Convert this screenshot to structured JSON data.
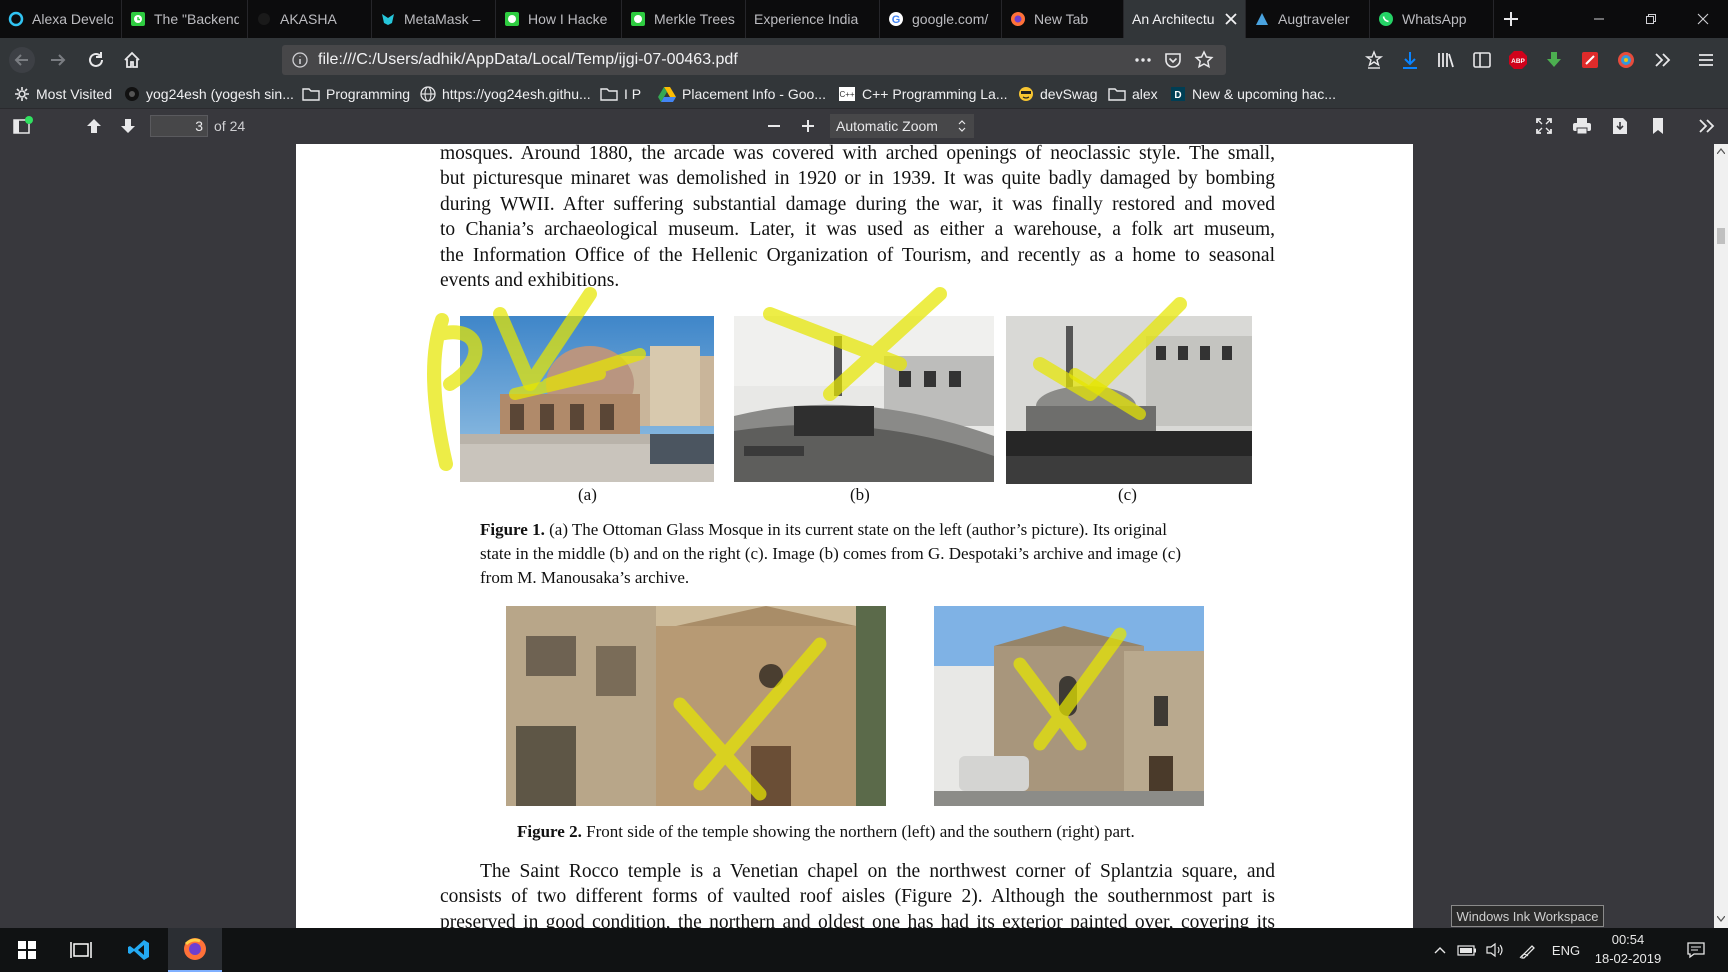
{
  "tabs": [
    {
      "title": "Alexa Develo",
      "icon": "alexa-icon",
      "active": false
    },
    {
      "title": "The \"Backend",
      "icon": "green-clock-icon",
      "active": false
    },
    {
      "title": "AKASHA",
      "icon": "akasha-icon",
      "active": false
    },
    {
      "title": "MetaMask –",
      "icon": "metamask-icon",
      "active": false
    },
    {
      "title": "How I Hacke",
      "icon": "green-clock-icon",
      "active": false
    },
    {
      "title": "Merkle Trees",
      "icon": "green-clock-icon",
      "active": false
    },
    {
      "title": "Experience India",
      "icon": "",
      "active": false
    },
    {
      "title": "google.com/",
      "icon": "google-icon",
      "active": false
    },
    {
      "title": "New Tab",
      "icon": "firefox-icon",
      "active": false
    },
    {
      "title": "An Architectu",
      "icon": "",
      "active": true
    },
    {
      "title": "Augtraveler",
      "icon": "augtraveler-icon",
      "active": false
    },
    {
      "title": "WhatsApp",
      "icon": "whatsapp-icon",
      "active": false
    }
  ],
  "url": "file:///C:/Users/adhik/AppData/Local/Temp/ijgi-07-00463.pdf",
  "bookmarks": [
    {
      "label": "Most Visited",
      "icon": "gear-icon"
    },
    {
      "label": "yog24esh (yogesh sin...",
      "icon": "github-icon"
    },
    {
      "label": "Programming",
      "icon": "folder-icon"
    },
    {
      "label": "https://yog24esh.githu...",
      "icon": "globe-icon"
    },
    {
      "label": "I P",
      "icon": "folder-icon"
    },
    {
      "label": "Placement Info - Goo...",
      "icon": "drive-icon"
    },
    {
      "label": "C++ Programming La...",
      "icon": "cpp-icon"
    },
    {
      "label": "devSwag",
      "icon": "emoji-icon"
    },
    {
      "label": "alex",
      "icon": "folder-icon"
    },
    {
      "label": "New & upcoming hac...",
      "icon": "devpost-icon"
    }
  ],
  "pdf": {
    "page_number": "3",
    "page_count": "of 24",
    "zoom": "Automatic Zoom"
  },
  "document": {
    "top_paragraph": [
      "mosques. Around 1880, the arcade was covered with arched openings of neoclassic style. The small,",
      "but picturesque minaret was demolished in 1920 or in 1939. It was quite badly damaged by bombing",
      "during WWII. After suffering substantial damage during the war, it was finally restored and moved",
      "to Chania’s archaeological museum.  Later, it was used as either a warehouse, a folk art museum,",
      "the Information Office of the Hellenic Organization of Tourism, and recently as a home to seasonal",
      "events and exhibitions."
    ],
    "fig1_labels": [
      "(a)",
      "(b)",
      "(c)"
    ],
    "fig1_caption_bold": "Figure 1.",
    "fig1_caption_lines": [
      "(a) The Ottoman Glass Mosque in its current state on the left (author’s picture). Its original",
      "state in the middle (b) and on the right (c). Image (b) comes from G. Despotaki’s archive and image (c)",
      "from M. Manousaka’s archive."
    ],
    "fig2_caption_bold": "Figure 2.",
    "fig2_caption": "Front side of the temple showing the northern (left) and the southern (right) part.",
    "bottom_paragraph": [
      "The Saint Rocco temple is a Venetian chapel on the northwest corner of Splantzia square, and",
      "consists of two different forms of vaulted roof aisles (Figure 2).  Although the southernmost part is",
      "preserved in good condition, the northern and oldest one has had its exterior painted over, covering its"
    ]
  },
  "ink_workspace_label": "Windows Ink Workspace",
  "taskbar": {
    "language": "ENG",
    "time": "00:54",
    "date": "18-02-2019"
  },
  "colors": {
    "accent_blue": "#0a84ff",
    "highlight_yellow": "#e6e600",
    "abp_red": "#d0021b"
  }
}
